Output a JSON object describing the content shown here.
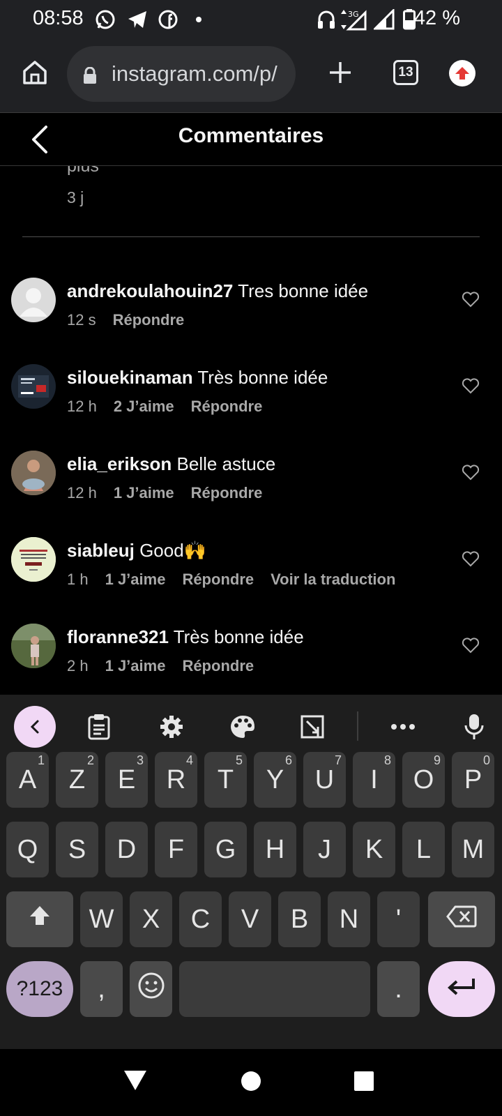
{
  "status_bar": {
    "time": "08:58",
    "network": "3G",
    "battery": "42 %",
    "icons": [
      "whatsapp-icon",
      "telegram-icon",
      "facebook-icon",
      "dot-icon",
      "headphones-icon",
      "data-arrows-icon",
      "signal-icon",
      "battery-icon"
    ]
  },
  "browser": {
    "url": "instagram.com/p/",
    "tab_count": "13",
    "icons": [
      "home-icon",
      "lock-icon",
      "new-tab-icon",
      "tabs-icon",
      "update-icon"
    ]
  },
  "header": {
    "title": "Commentaires"
  },
  "previous_comment": {
    "text_tail": "plus",
    "time": "3 j"
  },
  "comments": [
    {
      "username": "andrekoulahouin27",
      "text": "Tres bonne idée",
      "time": "12 s",
      "likes": "",
      "reply": "Répondre",
      "translate": ""
    },
    {
      "username": "silouekinaman",
      "text": "Très bonne idée",
      "time": "12 h",
      "likes": "2 J’aime",
      "reply": "Répondre",
      "translate": ""
    },
    {
      "username": "elia_erikson",
      "text": "Belle astuce",
      "time": "12 h",
      "likes": "1 J’aime",
      "reply": "Répondre",
      "translate": ""
    },
    {
      "username": "siableuj",
      "text": "Good🙌",
      "time": "1 h",
      "likes": "1 J’aime",
      "reply": "Répondre",
      "translate": "Voir la traduction"
    },
    {
      "username": "floranne321",
      "text": "Très bonne idée",
      "time": "2 h",
      "likes": "1 J’aime",
      "reply": "Répondre",
      "translate": ""
    }
  ],
  "keyboard": {
    "row1": [
      {
        "k": "A",
        "h": "1"
      },
      {
        "k": "Z",
        "h": "2"
      },
      {
        "k": "E",
        "h": "3"
      },
      {
        "k": "R",
        "h": "4"
      },
      {
        "k": "T",
        "h": "5"
      },
      {
        "k": "Y",
        "h": "6"
      },
      {
        "k": "U",
        "h": "7"
      },
      {
        "k": "I",
        "h": "8"
      },
      {
        "k": "O",
        "h": "9"
      },
      {
        "k": "P",
        "h": "0"
      }
    ],
    "row2": [
      "Q",
      "S",
      "D",
      "F",
      "G",
      "H",
      "J",
      "K",
      "L",
      "M"
    ],
    "row3": [
      "W",
      "X",
      "C",
      "V",
      "B",
      "N",
      "'"
    ],
    "symbols": "?123",
    "comma": ",",
    "period": ".",
    "toolbar_icons": [
      "back-icon",
      "clipboard-icon",
      "settings-icon",
      "palette-icon",
      "crop-icon",
      "more-icon",
      "mic-icon"
    ]
  },
  "colors": {
    "background": "#000000",
    "chrome": "#202124",
    "keyboard": "#1e1e1e",
    "key": "#3b3b3b",
    "accent_pink": "#f1d8f5",
    "accent_purple": "#b9a7c7",
    "muted_text": "#a8a8a8"
  }
}
